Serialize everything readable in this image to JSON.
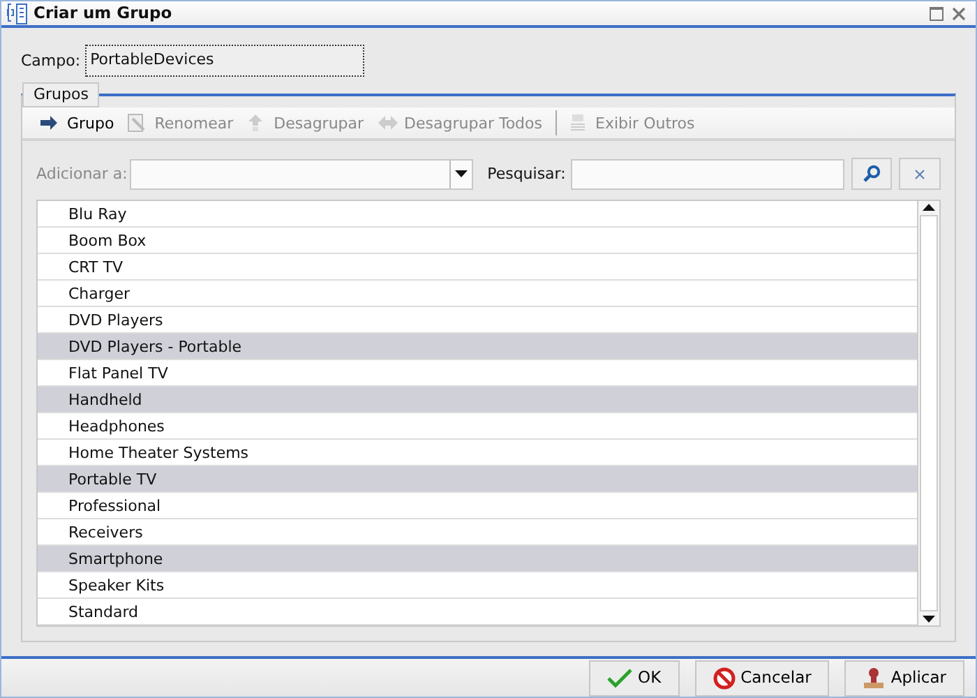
{
  "window": {
    "title": "Criar um Grupo"
  },
  "field": {
    "label": "Campo:",
    "value": "PortableDevices"
  },
  "group_box": {
    "legend": "Grupos"
  },
  "toolbar": [
    {
      "label": "Grupo",
      "kind": "arrow",
      "disabled": false
    },
    {
      "label": "Renomear",
      "kind": "rename",
      "disabled": true
    },
    {
      "label": "Desagrupar",
      "kind": "ungroup",
      "disabled": true
    },
    {
      "label": "Desagrupar Todos",
      "kind": "ungroup_all",
      "disabled": true
    },
    {
      "label": "Exibir Outros",
      "kind": "show",
      "disabled": true
    }
  ],
  "add_to": {
    "label": "Adicionar a:",
    "disabled": true
  },
  "search": {
    "label": "Pesquisar:"
  },
  "items": [
    {
      "label": "Blu Ray",
      "selected": false
    },
    {
      "label": "Boom Box",
      "selected": false
    },
    {
      "label": "CRT TV",
      "selected": false
    },
    {
      "label": "Charger",
      "selected": false
    },
    {
      "label": "DVD Players",
      "selected": false
    },
    {
      "label": "DVD Players - Portable",
      "selected": true
    },
    {
      "label": "Flat Panel TV",
      "selected": false
    },
    {
      "label": "Handheld",
      "selected": true
    },
    {
      "label": "Headphones",
      "selected": false
    },
    {
      "label": "Home Theater Systems",
      "selected": false
    },
    {
      "label": "Portable TV",
      "selected": true
    },
    {
      "label": "Professional",
      "selected": false
    },
    {
      "label": "Receivers",
      "selected": false
    },
    {
      "label": "Smartphone",
      "selected": true
    },
    {
      "label": "Speaker Kits",
      "selected": false
    },
    {
      "label": "Standard",
      "selected": false
    }
  ],
  "buttons": [
    {
      "label": "OK",
      "kind": "ok"
    },
    {
      "label": "Cancelar",
      "kind": "cancel"
    },
    {
      "label": "Aplicar",
      "kind": "apply"
    }
  ]
}
